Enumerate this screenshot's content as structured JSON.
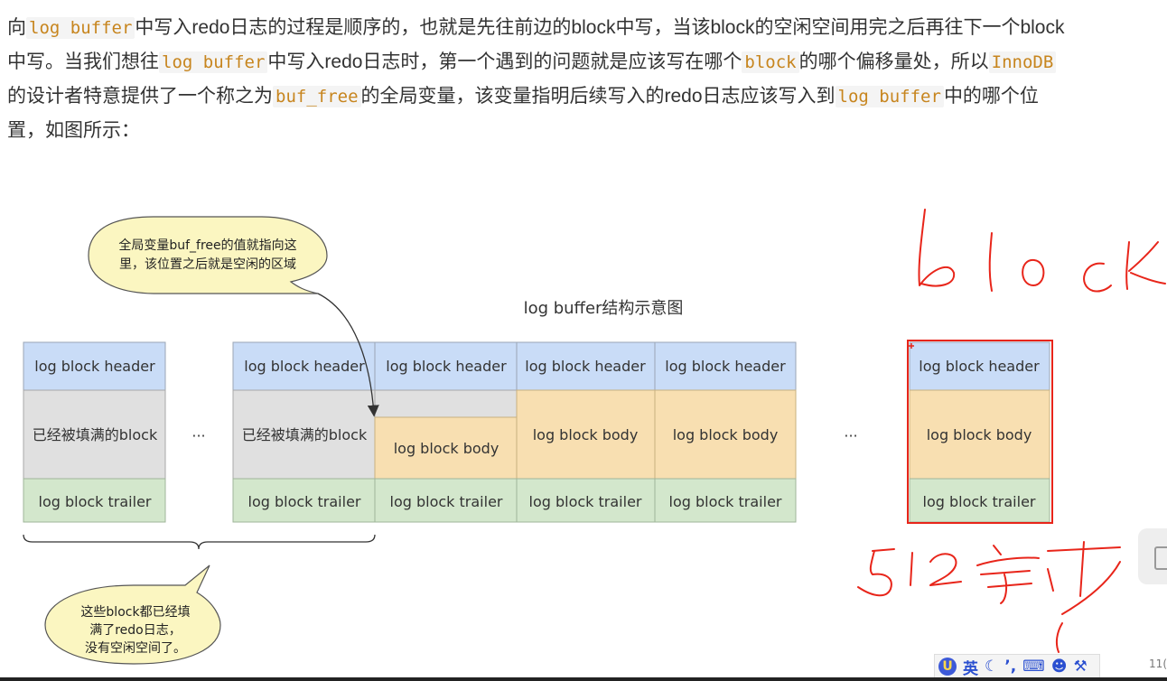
{
  "paragraph": {
    "s1": "向",
    "c1": "log buffer",
    "s2": "中写入redo日志的过程是顺序的，也就是先往前边的block中写，当该block的空闲空间用完之后再往下一个block中写。当我们想往",
    "c2": "log buffer",
    "s3": "中写入redo日志时，第一个遇到的问题就是应该写在哪个",
    "c3": "block",
    "s4": "的哪个偏移量处，所以",
    "c4": "InnoDB",
    "s5": "的设计者特意提供了一个称之为",
    "c5": "buf_free",
    "s6": "的全局变量，该变量指明后续写入的redo日志应该写入到",
    "c6": "log buffer",
    "s7": "中的哪个位置，如图所示："
  },
  "diagram": {
    "title": "log buffer结构示意图",
    "header_label": "log block header",
    "filled_label": "已经被填满的block",
    "body_label": "log block body",
    "trailer_label": "log block trailer",
    "ellipsis": "···",
    "bubble_top": {
      "line1": "全局变量buf_free的值就指向这",
      "line2": "里，该位置之后就是空闲的区域"
    },
    "bubble_bottom": {
      "line1": "这些block都已经填",
      "line2": "满了redo日志，",
      "line3": "没有空闲空间了。"
    }
  },
  "colors": {
    "header_fill": "#c9dcf7",
    "filled_fill": "#e0e0e0",
    "body_fill": "#f8dfb1",
    "trailer_fill": "#d3e7cc",
    "bubble_fill": "#fbf6c1",
    "code_text": "#c7851e",
    "annotation_red": "#e8251a"
  },
  "ime_toolbar": {
    "logo": "U",
    "mode": "英"
  },
  "page_number": "11("
}
